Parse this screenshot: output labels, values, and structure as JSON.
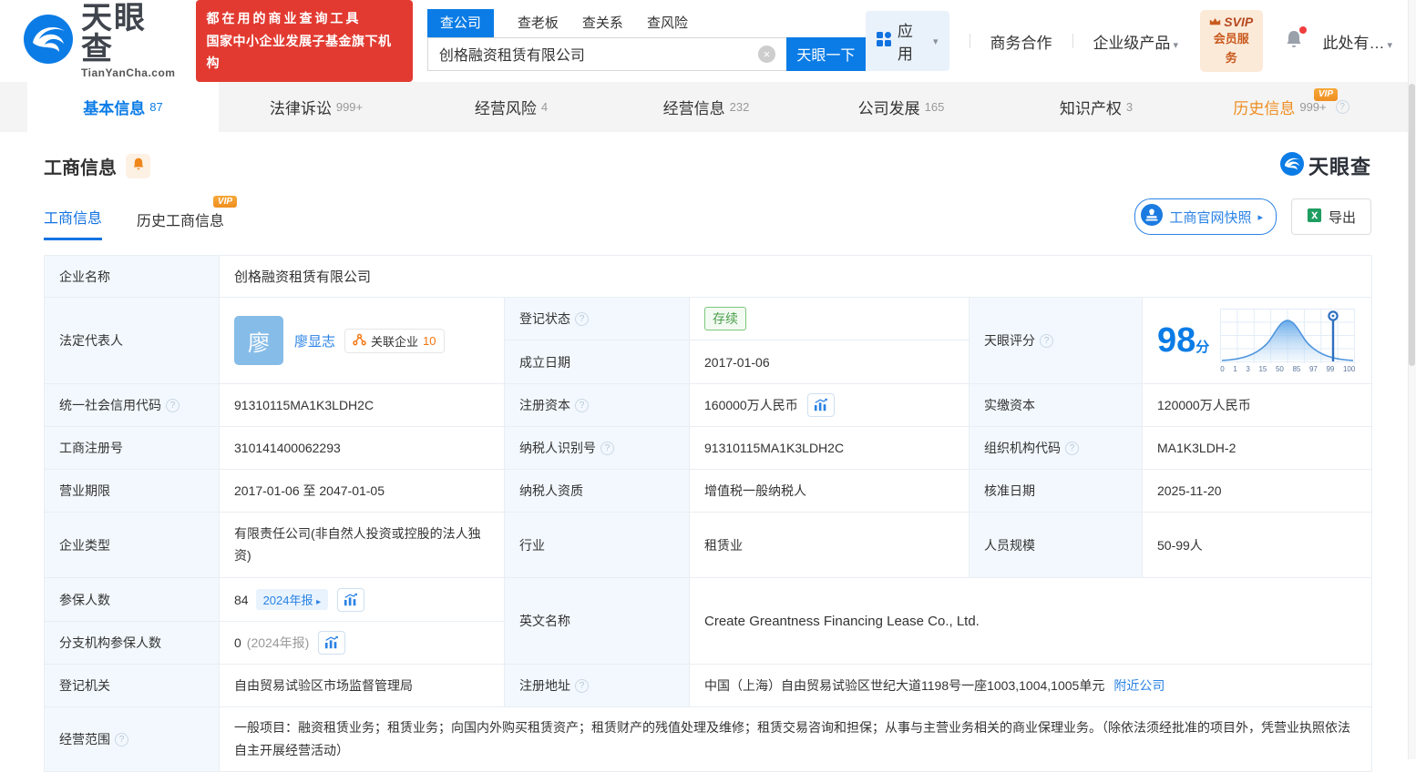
{
  "header": {
    "logo_title": "天眼查",
    "logo_domain": "TianYanCha.com",
    "promo_line1": "都在用的商业查询工具",
    "promo_line2": "国家中小企业发展子基金旗下机构",
    "search_tabs": [
      {
        "label": "查公司"
      },
      {
        "label": "查老板"
      },
      {
        "label": "查关系"
      },
      {
        "label": "查风险"
      }
    ],
    "search_value": "创格融资租赁有限公司",
    "search_button": "天眼一下",
    "apps_label": "应用",
    "biz_coop": "商务合作",
    "enterprise_products": "企业级产品",
    "svip_top": "SVIP",
    "svip_bottom": "会员服务",
    "account_label": "此处有…"
  },
  "nav_tabs": [
    {
      "label": "基本信息",
      "count": "87"
    },
    {
      "label": "法律诉讼",
      "count": "999+"
    },
    {
      "label": "经营风险",
      "count": "4"
    },
    {
      "label": "经营信息",
      "count": "232"
    },
    {
      "label": "公司发展",
      "count": "165"
    },
    {
      "label": "知识产权",
      "count": "3"
    },
    {
      "label": "历史信息",
      "count": "999+",
      "vip": "VIP"
    }
  ],
  "section": {
    "title": "工商信息",
    "subtab_current": "工商信息",
    "subtab_history": "历史工商信息",
    "vip": "VIP",
    "snapshot_button": "工商官网快照",
    "export_button": "导出",
    "watermark": "天眼查"
  },
  "table": {
    "company_name_label": "企业名称",
    "company_name": "创格融资租赁有限公司",
    "legal_rep_label": "法定代表人",
    "legal_rep_avatar": "廖",
    "legal_rep_name": "廖显志",
    "related_companies_label": "关联企业",
    "related_companies_count": "10",
    "reg_status_label": "登记状态",
    "reg_status": "存续",
    "establish_date_label": "成立日期",
    "establish_date": "2017-01-06",
    "score_label": "天眼评分",
    "score_value": "98",
    "score_unit": "分",
    "score_axis": [
      "0",
      "1",
      "3",
      "15",
      "50",
      "85",
      "97",
      "99",
      "100"
    ],
    "credit_code_label": "统一社会信用代码",
    "credit_code": "91310115MA1K3LDH2C",
    "reg_capital_label": "注册资本",
    "reg_capital": "160000万人民币",
    "paid_capital_label": "实缴资本",
    "paid_capital": "120000万人民币",
    "reg_number_label": "工商注册号",
    "reg_number": "310141400062293",
    "taxpayer_id_label": "纳税人识别号",
    "taxpayer_id": "91310115MA1K3LDH2C",
    "org_code_label": "组织机构代码",
    "org_code": "MA1K3LDH-2",
    "business_term_label": "营业期限",
    "business_term": "2017-01-06 至 2047-01-05",
    "taxpayer_quality_label": "纳税人资质",
    "taxpayer_quality": "增值税一般纳税人",
    "approval_date_label": "核准日期",
    "approval_date": "2025-11-20",
    "company_type_label": "企业类型",
    "company_type": "有限责任公司(非自然人投资或控股的法人独资)",
    "industry_label": "行业",
    "industry": "租赁业",
    "staff_size_label": "人员规模",
    "staff_size": "50-99人",
    "insured_label": "参保人数",
    "insured_value": "84",
    "insured_badge": "2024年报",
    "english_name_label": "英文名称",
    "english_name": "Create Greantness Financing Lease Co., Ltd.",
    "branch_insured_label": "分支机构参保人数",
    "branch_insured_value": "0",
    "branch_insured_note": "(2024年报)",
    "reg_authority_label": "登记机关",
    "reg_authority": "自由贸易试验区市场监督管理局",
    "reg_address_label": "注册地址",
    "reg_address": "中国（上海）自由贸易试验区世纪大道1198号一座1003,1004,1005单元",
    "nearby_link": "附近公司",
    "business_scope_label": "经营范围",
    "business_scope": "一般项目：融资租赁业务；租赁业务；向国内外购买租赁资产；租赁财产的残值处理及维修；租赁交易咨询和担保；从事与主营业务相关的商业保理业务。（除依法须经批准的项目外，凭营业执照依法自主开展经营活动）"
  },
  "colors": {
    "brand_blue": "#0b7ce6",
    "link_blue": "#2a82e4",
    "promo_red": "#e23a31",
    "vip_orange": "#efa02c",
    "history_orange": "#ef8e21",
    "status_green": "#4ba04b"
  }
}
